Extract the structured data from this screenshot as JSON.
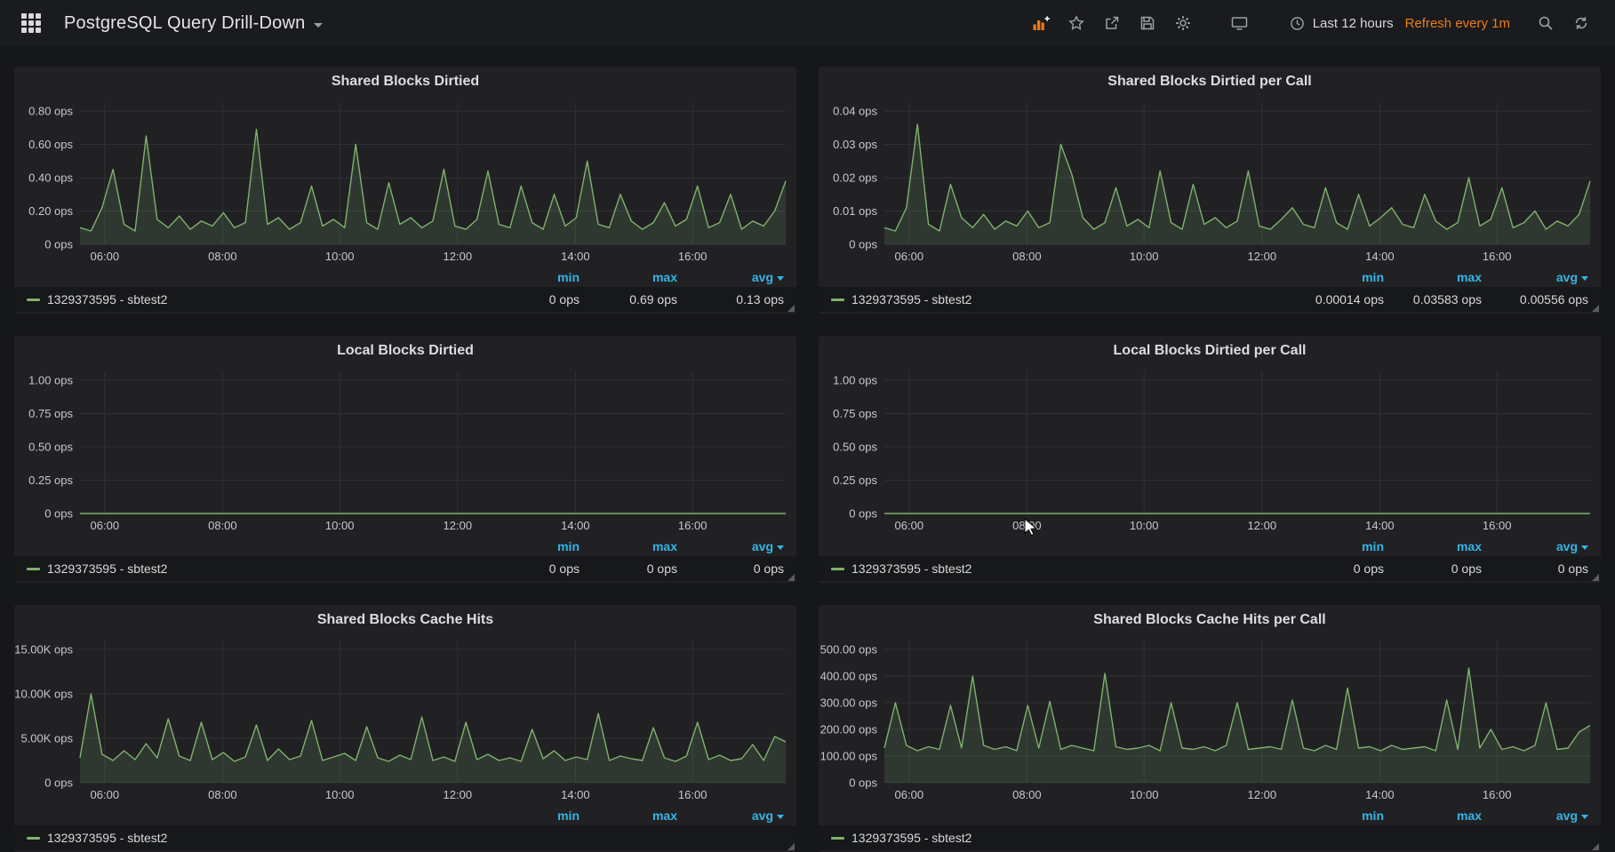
{
  "navbar": {
    "title": "PostgreSQL Query Drill-Down",
    "time_range_label": "Last 12 hours",
    "refresh_label": "Refresh every 1m"
  },
  "colors": {
    "accent_orange": "#eb7b18",
    "series_green": "#7eb26d",
    "legend_header_blue": "#33b5e5"
  },
  "legend_headers": {
    "min": "min",
    "max": "max",
    "avg": "avg"
  },
  "panels": [
    {
      "title": "Shared Blocks Dirtied",
      "series_name": "1329373595 - sbtest2",
      "stats": {
        "min": "0 ops",
        "max": "0.69 ops",
        "avg": "0.13 ops"
      },
      "chart_data": {
        "type": "area",
        "unit": "ops",
        "ylim": [
          0,
          0.8
        ],
        "yticks": [
          0,
          0.2,
          0.4,
          0.6,
          0.8
        ],
        "ytick_labels": [
          "0 ops",
          "0.20 ops",
          "0.40 ops",
          "0.60 ops",
          "0.80 ops"
        ],
        "x_tick_fractions": [
          0.035,
          0.202,
          0.368,
          0.535,
          0.702,
          0.868
        ],
        "x_tick_labels": [
          "06:00",
          "08:00",
          "10:00",
          "12:00",
          "14:00",
          "16:00"
        ],
        "values": [
          0.1,
          0.08,
          0.22,
          0.45,
          0.12,
          0.08,
          0.65,
          0.15,
          0.1,
          0.17,
          0.09,
          0.14,
          0.11,
          0.19,
          0.1,
          0.13,
          0.69,
          0.12,
          0.16,
          0.09,
          0.13,
          0.35,
          0.11,
          0.15,
          0.1,
          0.6,
          0.13,
          0.09,
          0.37,
          0.12,
          0.16,
          0.1,
          0.14,
          0.45,
          0.11,
          0.09,
          0.15,
          0.44,
          0.12,
          0.1,
          0.35,
          0.13,
          0.09,
          0.3,
          0.11,
          0.16,
          0.5,
          0.12,
          0.1,
          0.3,
          0.14,
          0.09,
          0.13,
          0.25,
          0.11,
          0.15,
          0.35,
          0.1,
          0.13,
          0.3,
          0.09,
          0.14,
          0.11,
          0.2,
          0.38
        ]
      }
    },
    {
      "title": "Shared Blocks Dirtied per Call",
      "series_name": "1329373595 - sbtest2",
      "stats": {
        "min": "0.00014 ops",
        "max": "0.03583 ops",
        "avg": "0.00556 ops"
      },
      "chart_data": {
        "type": "area",
        "unit": "ops",
        "ylim": [
          0,
          0.04
        ],
        "yticks": [
          0,
          0.01,
          0.02,
          0.03,
          0.04
        ],
        "ytick_labels": [
          "0 ops",
          "0.01 ops",
          "0.02 ops",
          "0.03 ops",
          "0.04 ops"
        ],
        "x_tick_fractions": [
          0.035,
          0.202,
          0.368,
          0.535,
          0.702,
          0.868
        ],
        "x_tick_labels": [
          "06:00",
          "08:00",
          "10:00",
          "12:00",
          "14:00",
          "16:00"
        ],
        "values": [
          0.005,
          0.004,
          0.011,
          0.036,
          0.006,
          0.004,
          0.018,
          0.008,
          0.005,
          0.009,
          0.0045,
          0.007,
          0.0055,
          0.01,
          0.005,
          0.0065,
          0.03,
          0.021,
          0.008,
          0.0045,
          0.0065,
          0.017,
          0.0055,
          0.0075,
          0.005,
          0.022,
          0.0065,
          0.0045,
          0.018,
          0.006,
          0.008,
          0.005,
          0.007,
          0.022,
          0.0055,
          0.0045,
          0.0075,
          0.011,
          0.006,
          0.005,
          0.017,
          0.0065,
          0.0045,
          0.015,
          0.0055,
          0.008,
          0.011,
          0.006,
          0.005,
          0.015,
          0.007,
          0.0045,
          0.0065,
          0.02,
          0.0055,
          0.0075,
          0.017,
          0.005,
          0.0065,
          0.01,
          0.0045,
          0.007,
          0.0055,
          0.009,
          0.019
        ]
      }
    },
    {
      "title": "Local Blocks Dirtied",
      "series_name": "1329373595 - sbtest2",
      "stats": {
        "min": "0 ops",
        "max": "0 ops",
        "avg": "0 ops"
      },
      "chart_data": {
        "type": "area",
        "unit": "ops",
        "ylim": [
          0,
          1.0
        ],
        "yticks": [
          0,
          0.25,
          0.5,
          0.75,
          1.0
        ],
        "ytick_labels": [
          "0 ops",
          "0.25 ops",
          "0.50 ops",
          "0.75 ops",
          "1.00 ops"
        ],
        "x_tick_fractions": [
          0.035,
          0.202,
          0.368,
          0.535,
          0.702,
          0.868
        ],
        "x_tick_labels": [
          "06:00",
          "08:00",
          "10:00",
          "12:00",
          "14:00",
          "16:00"
        ],
        "values": [
          0,
          0
        ]
      }
    },
    {
      "title": "Local Blocks Dirtied per Call",
      "series_name": "1329373595 - sbtest2",
      "stats": {
        "min": "0 ops",
        "max": "0 ops",
        "avg": "0 ops"
      },
      "chart_data": {
        "type": "area",
        "unit": "ops",
        "ylim": [
          0,
          1.0
        ],
        "yticks": [
          0,
          0.25,
          0.5,
          0.75,
          1.0
        ],
        "ytick_labels": [
          "0 ops",
          "0.25 ops",
          "0.50 ops",
          "0.75 ops",
          "1.00 ops"
        ],
        "x_tick_fractions": [
          0.035,
          0.202,
          0.368,
          0.535,
          0.702,
          0.868
        ],
        "x_tick_labels": [
          "06:00",
          "08:00",
          "10:00",
          "12:00",
          "14:00",
          "16:00"
        ],
        "values": [
          0,
          0
        ]
      }
    },
    {
      "title": "Shared Blocks Cache Hits",
      "series_name": "1329373595 - sbtest2",
      "stats": {
        "min": "",
        "max": "",
        "avg": ""
      },
      "chart_data": {
        "type": "area",
        "unit": "ops",
        "ylim": [
          0,
          15000
        ],
        "yticks": [
          0,
          5000,
          10000,
          15000
        ],
        "ytick_labels": [
          "0 ops",
          "5.00K ops",
          "10.00K ops",
          "15.00K ops"
        ],
        "x_tick_fractions": [
          0.035,
          0.202,
          0.368,
          0.535,
          0.702,
          0.868
        ],
        "x_tick_labels": [
          "06:00",
          "08:00",
          "10:00",
          "12:00",
          "14:00",
          "16:00"
        ],
        "values": [
          2800,
          10000,
          3200,
          2500,
          3600,
          2600,
          4400,
          2800,
          7200,
          3000,
          2500,
          6800,
          2600,
          3400,
          2400,
          2900,
          6500,
          2500,
          3800,
          2600,
          3000,
          7000,
          2500,
          2900,
          3300,
          2500,
          6300,
          2800,
          2400,
          3100,
          2600,
          7400,
          2500,
          2900,
          2400,
          6800,
          2600,
          3200,
          2500,
          2800,
          2400,
          6000,
          2700,
          3600,
          2500,
          2900,
          2600,
          7800,
          2500,
          3000,
          2700,
          2500,
          6200,
          2800,
          2400,
          3000,
          6800,
          2600,
          3100,
          2500,
          2700,
          4300,
          2500,
          5200,
          4600
        ]
      }
    },
    {
      "title": "Shared Blocks Cache Hits per Call",
      "series_name": "1329373595 - sbtest2",
      "stats": {
        "min": "",
        "max": "",
        "avg": ""
      },
      "chart_data": {
        "type": "area",
        "unit": "ops",
        "ylim": [
          0,
          500
        ],
        "yticks": [
          0,
          100,
          200,
          300,
          400,
          500
        ],
        "ytick_labels": [
          "0 ops",
          "100.00 ops",
          "200.00 ops",
          "300.00 ops",
          "400.00 ops",
          "500.00 ops"
        ],
        "x_tick_fractions": [
          0.035,
          0.202,
          0.368,
          0.535,
          0.702,
          0.868
        ],
        "x_tick_labels": [
          "06:00",
          "08:00",
          "10:00",
          "12:00",
          "14:00",
          "16:00"
        ],
        "values": [
          130,
          300,
          140,
          120,
          135,
          125,
          290,
          130,
          400,
          140,
          125,
          135,
          120,
          290,
          130,
          305,
          125,
          140,
          130,
          120,
          410,
          135,
          125,
          130,
          140,
          120,
          300,
          130,
          125,
          135,
          120,
          140,
          300,
          125,
          130,
          135,
          125,
          310,
          130,
          120,
          140,
          125,
          355,
          130,
          135,
          120,
          140,
          125,
          130,
          135,
          120,
          310,
          125,
          430,
          130,
          200,
          125,
          135,
          120,
          140,
          300,
          125,
          130,
          190,
          215
        ]
      }
    }
  ]
}
